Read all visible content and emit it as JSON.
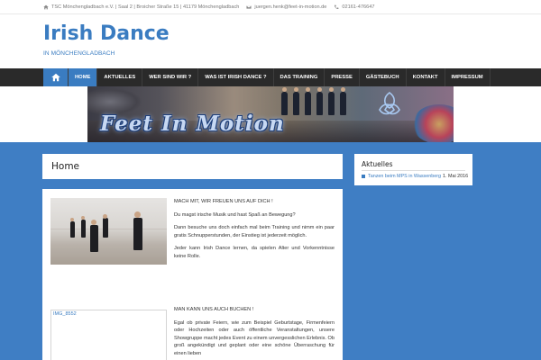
{
  "topbar": {
    "address": "TSC Mönchengladbach e.V. | Saal 2 | Broicher Straße 15 | 41179 Mönchengladbach",
    "email": "juergen.henk@feet-in-motion.de",
    "phone": "02161-476647"
  },
  "site": {
    "title": "Irish Dance",
    "tagline": "in Mönchengladbach"
  },
  "nav": {
    "items": [
      {
        "label": "Home"
      },
      {
        "label": "Aktuelles"
      },
      {
        "label": "Wer sind wir ?"
      },
      {
        "label": "Was ist Irish Dance ?"
      },
      {
        "label": "Das Training"
      },
      {
        "label": "Presse"
      },
      {
        "label": "Gästebuch"
      },
      {
        "label": "Kontakt"
      },
      {
        "label": "Impressum"
      }
    ]
  },
  "banner": {
    "logo_text": "Feet In Motion"
  },
  "page": {
    "title": "Home",
    "section1": {
      "heading": "MACH MIT, WIR FREUEN UNS AUF DICH !",
      "p1": "Du magst irische Musik und hast Spaß an Bewegung?",
      "p2": "Dann besuche uns doch einfach mal beim Training und nimm ein paar gratis Schnupperstunden, der Einstieg ist jederzeit möglich.",
      "p3": "Jeder kann Irish Dance lernen, da spielen Alter und Vorkenntnisse keine Rolle."
    },
    "section2": {
      "heading": "MAN KANN UNS AUCH BUCHEN !",
      "p1": "Egal ob private Feiern, wie zum Beispiel Geburtstage, Firmenfeiern oder Hochzeiten oder auch öffentliche Veranstaltungen, unsere Showgruppe macht jedes Event zu einem unvergesslichen Erlebnis. Ob groß angekündigt und geplant oder eine schöne Überraschung für einen lieben"
    },
    "image2_alt": "IMG_8552"
  },
  "sidebar": {
    "widget_title": "Aktuelles",
    "item_link": "Tanzen beim MPS in Wassenberg",
    "item_date": "1. Mai 2016"
  },
  "colors": {
    "accent": "#3a7cc1",
    "content_bg": "#3f7ec4",
    "navbar": "#2a2a2a"
  }
}
